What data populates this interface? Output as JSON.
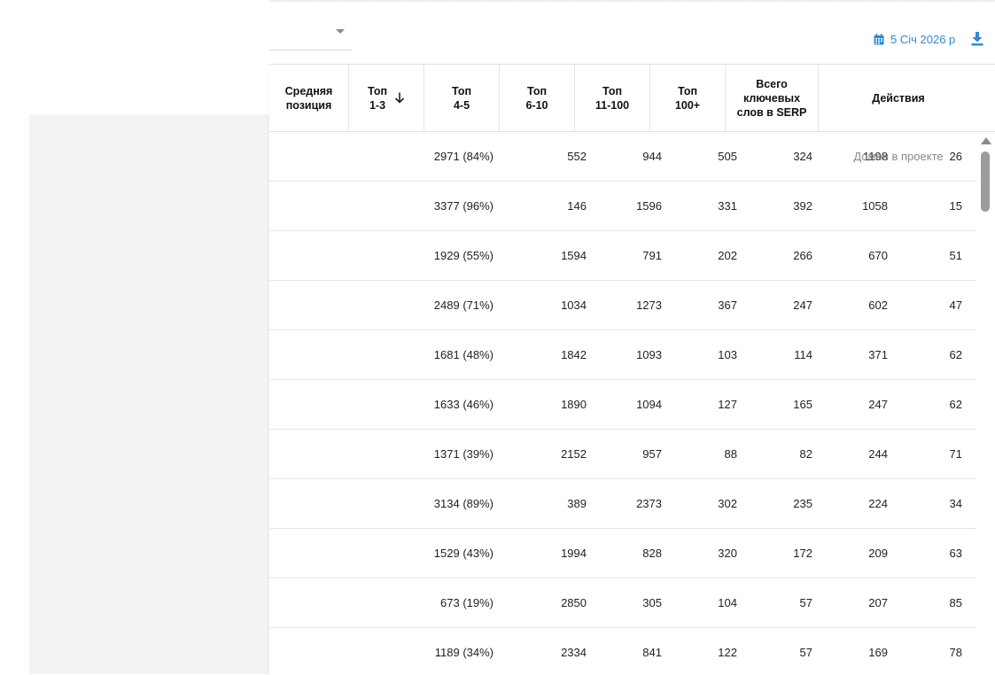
{
  "toolbar": {
    "date_label": "5 Січ 2026 р",
    "accent_color": "#2d8ad6",
    "calendar_icon": "calendar-icon",
    "download_icon": "download-icon"
  },
  "table": {
    "columns": [
      {
        "label": "Средняя\nпозиция"
      },
      {
        "label": "Топ\n1-3",
        "sorted": "desc"
      },
      {
        "label": "Топ\n4-5"
      },
      {
        "label": "Топ\n6-10"
      },
      {
        "label": "Топ\n11-100"
      },
      {
        "label": "Топ\n100+"
      },
      {
        "label": "Всего\nключевых\nслов в SERP"
      },
      {
        "label": "Действия"
      }
    ],
    "rows": [
      {
        "avg": "26",
        "t13": "1198",
        "t45": "324",
        "t610": "505",
        "t11100": "944",
        "t100p": "552",
        "total": "2971 (84%)",
        "action": "Домен в проекте"
      },
      {
        "avg": "15",
        "t13": "1058",
        "t45": "392",
        "t610": "331",
        "t11100": "1596",
        "t100p": "146",
        "total": "3377 (96%)",
        "action": ""
      },
      {
        "avg": "51",
        "t13": "670",
        "t45": "266",
        "t610": "202",
        "t11100": "791",
        "t100p": "1594",
        "total": "1929 (55%)",
        "action": ""
      },
      {
        "avg": "47",
        "t13": "602",
        "t45": "247",
        "t610": "367",
        "t11100": "1273",
        "t100p": "1034",
        "total": "2489 (71%)",
        "action": ""
      },
      {
        "avg": "62",
        "t13": "371",
        "t45": "114",
        "t610": "103",
        "t11100": "1093",
        "t100p": "1842",
        "total": "1681 (48%)",
        "action": ""
      },
      {
        "avg": "62",
        "t13": "247",
        "t45": "165",
        "t610": "127",
        "t11100": "1094",
        "t100p": "1890",
        "total": "1633 (46%)",
        "action": ""
      },
      {
        "avg": "71",
        "t13": "244",
        "t45": "82",
        "t610": "88",
        "t11100": "957",
        "t100p": "2152",
        "total": "1371 (39%)",
        "action": ""
      },
      {
        "avg": "34",
        "t13": "224",
        "t45": "235",
        "t610": "302",
        "t11100": "2373",
        "t100p": "389",
        "total": "3134 (89%)",
        "action": ""
      },
      {
        "avg": "63",
        "t13": "209",
        "t45": "172",
        "t610": "320",
        "t11100": "828",
        "t100p": "1994",
        "total": "1529 (43%)",
        "action": ""
      },
      {
        "avg": "85",
        "t13": "207",
        "t45": "57",
        "t610": "104",
        "t11100": "305",
        "t100p": "2850",
        "total": "673 (19%)",
        "action": ""
      },
      {
        "avg": "78",
        "t13": "169",
        "t45": "57",
        "t610": "122",
        "t11100": "841",
        "t100p": "2334",
        "total": "1189 (34%)",
        "action": ""
      }
    ]
  }
}
